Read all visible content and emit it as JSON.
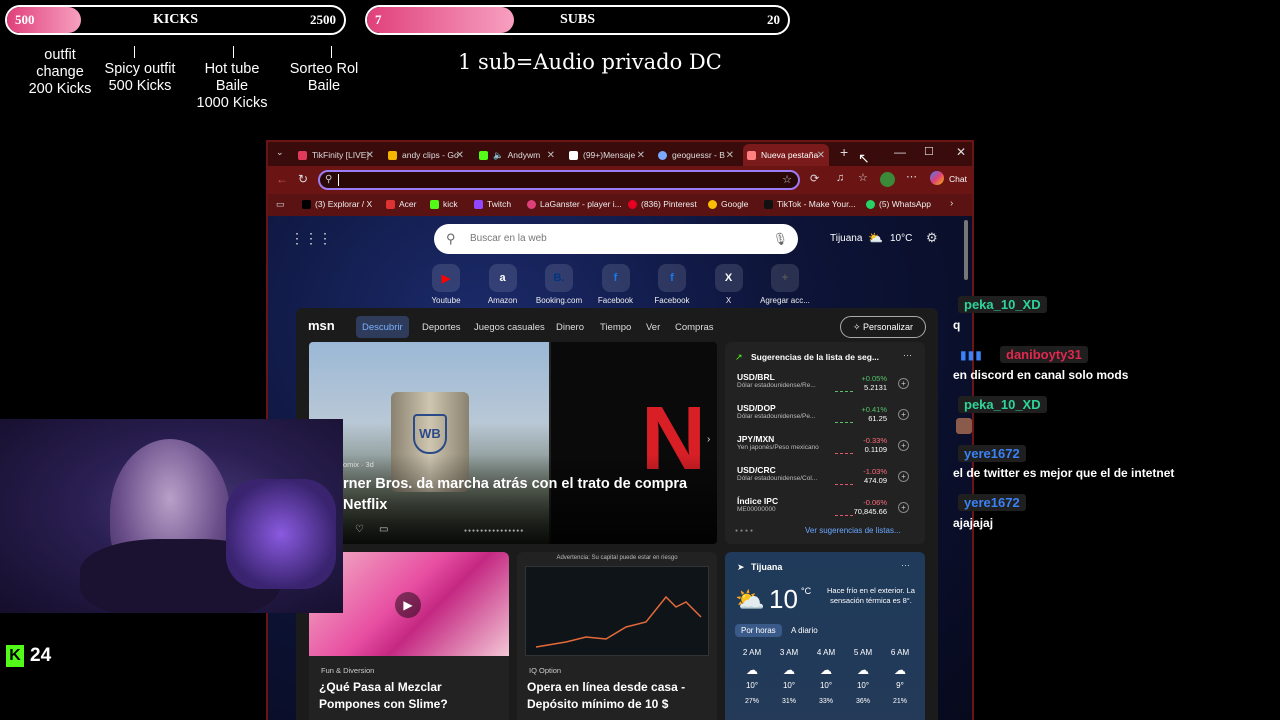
{
  "kicks_goal": {
    "start": "500",
    "title": "KICKS",
    "end": "2500",
    "progress": 0.22
  },
  "subs_goal": {
    "start": "7",
    "title": "SUBS",
    "end": "20",
    "progress": 0.35
  },
  "milestones": [
    {
      "text": "outfit\nchange\n200 Kicks"
    },
    {
      "text": "Spicy outfit\n500 Kicks"
    },
    {
      "text": "Hot tube\nBaile\n1000 Kicks"
    },
    {
      "text": "Sorteo Rol\nBaile"
    }
  ],
  "sub_note": "1 sub=Audio privado DC",
  "browser": {
    "tabs": [
      {
        "label": "TikFinity [LIVE]",
        "color": "#e03a5a"
      },
      {
        "label": "andy clips - Go",
        "color": "#f4b400"
      },
      {
        "label": "Andywm",
        "color": "#53fc18"
      },
      {
        "label": "(99+)Mensaje",
        "color": "#ffffff"
      },
      {
        "label": "geoguessr - B",
        "color": "#7aa8ff"
      },
      {
        "label": "Nueva pestaña",
        "color": "#ff8080"
      }
    ],
    "new_tab": "+",
    "minimize": "—",
    "maximize": "☐",
    "close": "✕",
    "address_value": "",
    "chat_label": "Chat",
    "bookmarks": [
      {
        "label": "(3) Explorar / X",
        "color": "#000"
      },
      {
        "label": "Acer",
        "color": "#d33"
      },
      {
        "label": "kick",
        "color": "#53fc18"
      },
      {
        "label": "Twitch",
        "color": "#9146ff"
      },
      {
        "label": "LaGanster - player i...",
        "color": "#e0407a"
      },
      {
        "label": "(836) Pinterest",
        "color": "#e60023"
      },
      {
        "label": "Google",
        "color": "#fbbc05"
      },
      {
        "label": "TikTok - Make Your...",
        "color": "#111"
      },
      {
        "label": "(5) WhatsApp",
        "color": "#25d366"
      }
    ]
  },
  "newtab": {
    "search_placeholder": "Buscar en la web",
    "weather_city": "Tijuana",
    "weather_temp": "10°C",
    "shortcuts": [
      {
        "label": "Youtube",
        "icon": "▶",
        "color": "#ff0000"
      },
      {
        "label": "Amazon",
        "icon": "a",
        "color": "#ffffff"
      },
      {
        "label": "Booking.com",
        "icon": "B.",
        "color": "#003580"
      },
      {
        "label": "Facebook",
        "icon": "f",
        "color": "#1877f2"
      },
      {
        "label": "Facebook",
        "icon": "f",
        "color": "#1877f2"
      },
      {
        "label": "X",
        "icon": "X",
        "color": "#000000"
      },
      {
        "label": "Agregar acc...",
        "icon": "+",
        "color": "#555555"
      }
    ]
  },
  "msn": {
    "logo": "msn",
    "nav": [
      "Descubrir",
      "Deportes",
      "Juegos casuales",
      "Dinero",
      "Tiempo",
      "Ver",
      "Compras"
    ],
    "personalize": "Personalizar",
    "hero_source": "omix · 3d",
    "hero_title": "rner Bros. da marcha atrás con el trato de compra Netflix",
    "finance_title": "Sugerencias de la lista de seg...",
    "finance": [
      {
        "sym": "USD/BRL",
        "desc": "Dólar estadounidense/Re...",
        "chg": "+0.05%",
        "val": "5.2131",
        "up": true
      },
      {
        "sym": "USD/DOP",
        "desc": "Dólar estadounidense/Pe...",
        "chg": "+0.41%",
        "val": "61.25",
        "up": true
      },
      {
        "sym": "JPY/MXN",
        "desc": "Yen japonés/Peso mexicano",
        "chg": "-0.33%",
        "val": "0.1109",
        "up": false
      },
      {
        "sym": "USD/CRC",
        "desc": "Dólar estadounidense/Col...",
        "chg": "-1.03%",
        "val": "474.09",
        "up": false
      },
      {
        "sym": "Índice IPC",
        "desc": "ME00000000",
        "chg": "-0.06%",
        "val": "70,845.66",
        "up": false
      }
    ],
    "finance_link": "Ver sugerencias de listas...",
    "card1_source": "Fun & Diversion",
    "card1_title": "¿Qué Pasa al Mezclar Pompones con Slime?",
    "card2_warning": "Advertencia: Su capital puede estar en riesgo",
    "card2_source": "IQ Option",
    "card2_title": "Opera en línea desde casa - Depósito mínimo de 10 $",
    "weather_city": "Tijuana",
    "weather_temp": "10",
    "weather_unit": "°C",
    "weather_note": "Hace frío en el exterior. La sensación térmica es 8°.",
    "weather_tabs": [
      "Por horas",
      "A diario"
    ],
    "hours": [
      {
        "h": "2 AM",
        "t": "10°",
        "p": "27%"
      },
      {
        "h": "3 AM",
        "t": "10°",
        "p": "31%"
      },
      {
        "h": "4 AM",
        "t": "10°",
        "p": "33%"
      },
      {
        "h": "5 AM",
        "t": "10°",
        "p": "36%"
      },
      {
        "h": "6 AM",
        "t": "9°",
        "p": "21%"
      }
    ]
  },
  "chat": [
    {
      "user": "peka_10_XD",
      "color": "#2fd49a",
      "msg": "q"
    },
    {
      "user": "daniboyty31",
      "color": "#e0284f",
      "msg": "en discord en canal solo mods"
    },
    {
      "user": "peka_10_XD",
      "color": "#2fd49a",
      "msg": ""
    },
    {
      "user": "yere1672",
      "color": "#3b82f6",
      "msg": "el de twitter es mejor que el de intetnet"
    },
    {
      "user": "yere1672",
      "color": "#3b82f6",
      "msg": "ajajajaj"
    }
  ],
  "kick_count": "24",
  "colors": {
    "accent": "#e0407a",
    "kick": "#53fc18",
    "browser_frame": "#6a1414"
  }
}
